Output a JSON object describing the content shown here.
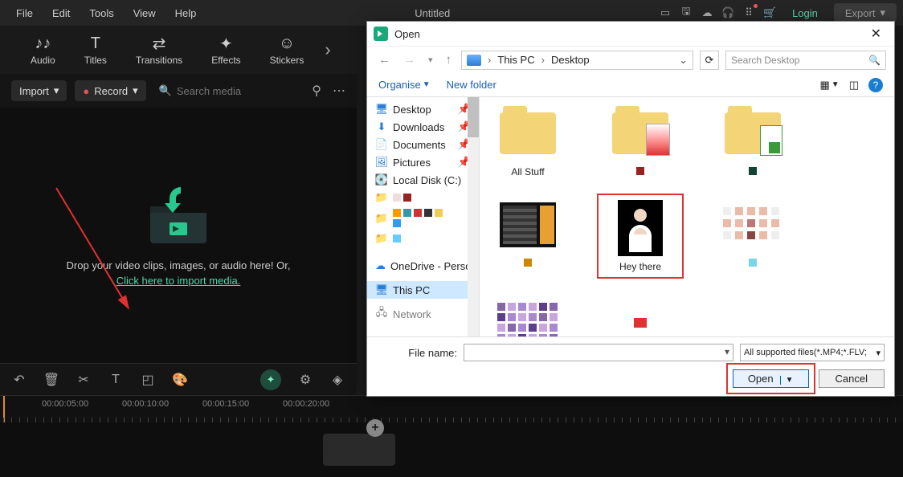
{
  "menubar": {
    "items": [
      "File",
      "Edit",
      "Tools",
      "View",
      "Help"
    ],
    "title": "Untitled",
    "login": "Login",
    "export": "Export"
  },
  "tabs": [
    {
      "key": "audio",
      "label": "Audio",
      "glyph": "♪♪"
    },
    {
      "key": "titles",
      "label": "Titles",
      "glyph": "T"
    },
    {
      "key": "transitions",
      "label": "Transitions",
      "glyph": "⇄"
    },
    {
      "key": "effects",
      "label": "Effects",
      "glyph": "✦"
    },
    {
      "key": "stickers",
      "label": "Stickers",
      "glyph": "☺"
    }
  ],
  "importbar": {
    "import": "Import",
    "record": "Record",
    "search_placeholder": "Search media"
  },
  "mediapanel": {
    "drop_text": "Drop your video clips, images, or audio here! Or,",
    "import_link": "Click here to import media."
  },
  "ruler": {
    "marks": [
      "00:00:05:00",
      "00:00:10:00",
      "00:00:15:00",
      "00:00:20:00"
    ]
  },
  "dialog": {
    "title": "Open",
    "crumb": [
      "This PC",
      "Desktop"
    ],
    "search_placeholder": "Search Desktop",
    "organise": "Organise",
    "new_folder": "New folder",
    "side": [
      {
        "icon": "desktop",
        "label": "Desktop",
        "color": "#2a7dd4"
      },
      {
        "icon": "download",
        "label": "Downloads",
        "color": "#2a7dd4"
      },
      {
        "icon": "doc",
        "label": "Documents",
        "color": "#2a7dd4"
      },
      {
        "icon": "pic",
        "label": "Pictures",
        "color": "#2a7dd4"
      },
      {
        "icon": "disk",
        "label": "Local Disk (C:)",
        "color": "#888"
      },
      {
        "icon": "cloud",
        "label": "OneDrive - Person",
        "color": "#2a7dd4"
      },
      {
        "icon": "pc",
        "label": "This PC",
        "color": "#2a7dd4",
        "selected": true
      },
      {
        "icon": "net",
        "label": "Network",
        "color": "#2a7dd4"
      }
    ],
    "files_row1": [
      {
        "type": "folder",
        "label": "All Stuff"
      },
      {
        "type": "folder",
        "label": "",
        "accent": "#d46"
      },
      {
        "type": "folder",
        "label": "",
        "accent": "#3a9a3a"
      },
      {
        "type": "folder",
        "label": "",
        "accent": "#333"
      }
    ],
    "files_row2_palette_colors": [
      "#d46",
      "#333",
      "#fb3",
      "#29c",
      "#7a3",
      "#c7d",
      "#29f",
      "#f80",
      "#555",
      "#ec5",
      "#39a",
      "#c44"
    ],
    "hey_there_label": "Hey there",
    "filename_label": "File name:",
    "filter": "All supported files(*.MP4;*.FLV;",
    "open": "Open",
    "cancel": "Cancel"
  }
}
